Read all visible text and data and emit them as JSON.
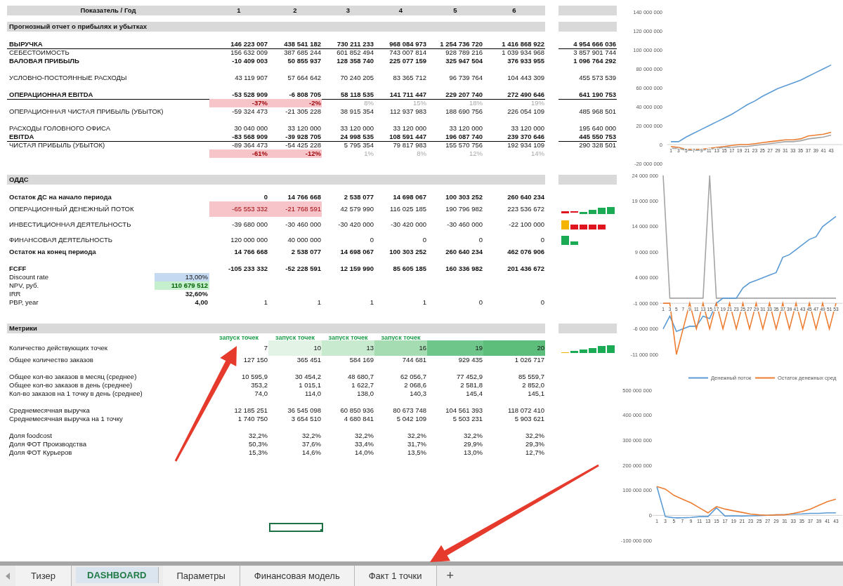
{
  "header": {
    "label": "Показатель / Год",
    "years": [
      "1",
      "2",
      "3",
      "4",
      "5",
      "6"
    ]
  },
  "sections": [
    {
      "title": "Прогнозный отчет о прибылях и убытках",
      "groups": [
        [
          {
            "label": "ВЫРУЧКА",
            "kind": "bold",
            "underline": true,
            "cells": [
              "146 223 007",
              "438 541 182",
              "730 211 233",
              "968 084 973",
              "1 254 736 720",
              "1 416 868 922"
            ],
            "total": "4 954 666 036"
          },
          {
            "label": "СЕБЕСТОИМОСТЬ",
            "kind": "normal",
            "cells": [
              "156 632 009",
              "387 685 244",
              "601 852 494",
              "743 007 814",
              "928 789 216",
              "1 039 934 968"
            ],
            "total": "3 857 901 744"
          },
          {
            "label": "ВАЛОВАЯ ПРИБЫЛЬ",
            "kind": "bold",
            "cells": [
              "-10 409 003",
              "50 855 937",
              "128 358 740",
              "225 077 159",
              "325 947 504",
              "376 933 955"
            ],
            "total": "1 096 764 292"
          }
        ],
        [
          {
            "label": "УСЛОВНО-ПОСТОЯННЫЕ РАСХОДЫ",
            "kind": "normal",
            "cells": [
              "43 119 907",
              "57 664 642",
              "70 240 205",
              "83 365 712",
              "96 739 764",
              "104 443 309"
            ],
            "total": "455 573 539"
          }
        ],
        [
          {
            "label": "ОПЕРАЦИОННАЯ EBITDA",
            "kind": "bold",
            "underline": true,
            "cells": [
              "-53 528 909",
              "-6 808 705",
              "58 118 535",
              "141 711 447",
              "229 207 740",
              "272 490 646"
            ],
            "total": "641 190 753"
          },
          {
            "kind": "pct",
            "cells": [
              {
                "text": "-37%",
                "highlighted": true
              },
              {
                "text": "-2%",
                "highlighted": true
              },
              {
                "text": "8%",
                "highlighted": false
              },
              {
                "text": "15%",
                "highlighted": false
              },
              {
                "text": "18%",
                "highlighted": false
              },
              {
                "text": "19%",
                "highlighted": false
              }
            ]
          },
          {
            "label": "ОПЕРАЦИОННАЯ ЧИСТАЯ ПРИБЫЛЬ (УБЫТОК)",
            "kind": "normal",
            "cells": [
              "-59 324 473",
              "-21 305 228",
              "38 915 354",
              "112 937 983",
              "188 690 756",
              "226 054 109"
            ],
            "total": "485 968 501"
          }
        ],
        [
          {
            "label": "РАСХОДЫ ГОЛОВНОГО ОФИСА",
            "kind": "normal",
            "cells": [
              "30 040 000",
              "33 120 000",
              "33 120 000",
              "33 120 000",
              "33 120 000",
              "33 120 000"
            ],
            "total": "195 640 000"
          },
          {
            "label": "EBITDA",
            "kind": "bold",
            "underline": true,
            "cells": [
              "-83 568 909",
              "-39 928 705",
              "24 998 535",
              "108 591 447",
              "196 087 740",
              "239 370 646"
            ],
            "total": "445 550 753"
          },
          {
            "label": "ЧИСТАЯ ПРИБЫЛЬ (УБЫТОК)",
            "kind": "normal",
            "cells": [
              "-89 364 473",
              "-54 425 228",
              "5 795 354",
              "79 817 983",
              "155 570 756",
              "192 934 109"
            ],
            "total": "290 328 501"
          },
          {
            "kind": "pct",
            "cells": [
              {
                "text": "-61%",
                "highlighted": true
              },
              {
                "text": "-12%",
                "highlighted": true
              },
              {
                "text": "1%",
                "highlighted": false
              },
              {
                "text": "8%",
                "highlighted": false
              },
              {
                "text": "12%",
                "highlighted": false
              },
              {
                "text": "14%",
                "highlighted": false
              }
            ]
          }
        ]
      ]
    },
    {
      "title": "ОДДС",
      "groups": [
        [
          {
            "label": "Остаток ДС на начало периода",
            "kind": "bold",
            "cells": [
              "0",
              "14 766 668",
              "2 538 077",
              "14 698 067",
              "100 303 252",
              "260 640 234"
            ]
          },
          {
            "label": "ОПЕРАЦИОННЫЙ ДЕНЕЖНЫЙ ПОТОК",
            "kind": "normal",
            "sparkline": {
              "kind": "cashflow"
            },
            "cells": [
              {
                "text": "-65 553 332",
                "highlighted": true
              },
              {
                "text": "-21 768 591",
                "highlighted": true
              },
              {
                "text": "42 579 990",
                "highlighted": false
              },
              {
                "text": "116 025 185",
                "highlighted": false
              },
              {
                "text": "190 796 982",
                "highlighted": false
              },
              {
                "text": "223 536 672",
                "highlighted": false
              }
            ]
          },
          {
            "label": "ИНВЕСТИЦИОННАЯ ДЕЯТЕЛЬНОСТЬ",
            "kind": "normal",
            "sparkline": {
              "kind": "investing"
            },
            "cells": [
              "-39 680 000",
              "-30 460 000",
              "-30 420 000",
              "-30 420 000",
              "-30 460 000",
              "-22 100 000"
            ]
          },
          {
            "label": "ФИНАНСОВАЯ ДЕЯТЕЛЬНОСТЬ",
            "kind": "normal",
            "sparkline": {
              "kind": "financing"
            },
            "cells": [
              "120 000 000",
              "40 000 000",
              "0",
              "0",
              "0",
              "0"
            ]
          },
          {
            "label": "Остаток на конец периода",
            "kind": "bold",
            "cells": [
              "14 766 668",
              "2 538 077",
              "14 698 067",
              "100 303 252",
              "260 640 234",
              "462 076 906"
            ]
          }
        ],
        [
          {
            "label": "FCFF",
            "kind": "bold",
            "cells": [
              "-105 233 332",
              "-52 228 591",
              "12 159 990",
              "85 605 185",
              "160 336 982",
              "201 436 672"
            ]
          },
          {
            "label": "Discount rate",
            "kind": "normal",
            "param": {
              "text": "13,00%",
              "kind": "input"
            }
          },
          {
            "label": "NPV, руб.",
            "kind": "normal",
            "param": {
              "text": "110 679 512",
              "kind": "result"
            }
          },
          {
            "label": "IRR",
            "kind": "normal",
            "param": {
              "text": "32,60%",
              "kind": "bold"
            }
          },
          {
            "label": "PBP, year",
            "kind": "normal",
            "param": {
              "text": "4,00",
              "kind": "bold"
            },
            "cells": [
              "1",
              "1",
              "1",
              "1",
              "0",
              "0"
            ]
          }
        ]
      ]
    },
    {
      "title": "Метрики",
      "launches": [
        "запуск точек",
        "запуск точек",
        "запуск точек",
        "запуск точек"
      ],
      "groups": [
        [
          {
            "label": "Количество действующих точек",
            "kind": "normal",
            "sparkline": {
              "kind": "growth"
            },
            "cells": [
              {
                "text": "7"
              },
              {
                "text": "10",
                "color": "#e3f4e7"
              },
              {
                "text": "13",
                "color": "#c8eacf"
              },
              {
                "text": "16",
                "color": "#a5dcb2"
              },
              {
                "text": "19",
                "color": "#6fc68a"
              },
              {
                "text": "20",
                "color": "#5dbd7b"
              }
            ]
          },
          {
            "label": "Общее количество заказов",
            "kind": "normal",
            "cells": [
              "127 150",
              "365 451",
              "584 169",
              "744 681",
              "929 435",
              "1 026 717"
            ]
          }
        ],
        [
          {
            "label": "Общее кол-во заказов в месяц (среднее)",
            "kind": "normal",
            "cells": [
              "10 595,9",
              "30 454,2",
              "48 680,7",
              "62 056,7",
              "77 452,9",
              "85 559,7"
            ]
          },
          {
            "label": "Общее кол-во заказов в день (среднее)",
            "kind": "normal",
            "cells": [
              "353,2",
              "1 015,1",
              "1 622,7",
              "2 068,6",
              "2 581,8",
              "2 852,0"
            ]
          },
          {
            "label": "Кол-во заказов на 1 точку в день (среднее)",
            "kind": "normal",
            "cells": [
              "74,0",
              "114,0",
              "138,0",
              "140,3",
              "145,4",
              "145,1"
            ]
          }
        ],
        [
          {
            "label": "Среднемесячная выручка",
            "kind": "normal",
            "cells": [
              "12 185 251",
              "36 545 098",
              "60 850 936",
              "80 673 748",
              "104 561 393",
              "118 072 410"
            ]
          },
          {
            "label": "Среднемесячная выручка на 1 точку",
            "kind": "normal",
            "cells": [
              "1 740 750",
              "3 654 510",
              "4 680 841",
              "5 042 109",
              "5 503 231",
              "5 903 621"
            ]
          }
        ],
        [
          {
            "label": "Доля foodcost",
            "kind": "normal",
            "cells": [
              "32,2%",
              "32,2%",
              "32,2%",
              "32,2%",
              "32,2%",
              "32,2%"
            ]
          },
          {
            "label": "Доля ФОТ Производства",
            "kind": "normal",
            "cells": [
              "50,3%",
              "37,6%",
              "33,4%",
              "31,7%",
              "29,9%",
              "29,3%"
            ]
          },
          {
            "label": "Доля ФОТ Курьеров",
            "kind": "normal",
            "cells": [
              "15,3%",
              "14,6%",
              "14,0%",
              "13,5%",
              "13,0%",
              "12,7%"
            ]
          }
        ]
      ]
    }
  ],
  "selection": {
    "visible": true
  },
  "charts": [
    {
      "chart_data": {
        "type": "line",
        "x": [
          1,
          3,
          5,
          7,
          9,
          11,
          13,
          15,
          17,
          19,
          21,
          23,
          25,
          27,
          29,
          31,
          33,
          35,
          37,
          39,
          41,
          43
        ],
        "xticks": [
          1,
          3,
          5,
          7,
          9,
          11,
          13,
          15,
          17,
          19,
          21,
          23,
          25,
          27,
          29,
          31,
          33,
          35,
          37,
          39,
          41,
          43
        ],
        "xlim": [
          0,
          46
        ],
        "ylim": [
          -20000000,
          140000000
        ],
        "yticks": [
          {
            "value": -20000000,
            "label": "-20 000 000"
          },
          {
            "value": 0,
            "label": "0"
          },
          {
            "value": 20000000,
            "label": "20 000 000"
          },
          {
            "value": 40000000,
            "label": "40 000 000"
          },
          {
            "value": 60000000,
            "label": "60 000 000"
          },
          {
            "value": 80000000,
            "label": "80 000 000"
          },
          {
            "value": 100000000,
            "label": "100 000 000"
          },
          {
            "value": 120000000,
            "label": "120 000 000"
          },
          {
            "value": 140000000,
            "label": "140 000 000"
          }
        ],
        "series": [
          {
            "color": "#5b9bd5",
            "values": [
              3000000,
              3000000,
              8000000,
              12000000,
              16000000,
              20000000,
              24000000,
              28000000,
              32000000,
              37000000,
              42000000,
              46000000,
              51000000,
              55000000,
              59000000,
              62000000,
              65000000,
              68000000,
              72000000,
              76000000,
              80000000,
              84000000
            ]
          },
          {
            "color": "#ed7d31",
            "values": [
              -2000000,
              -3000000,
              -5000000,
              -5000000,
              -5000000,
              -4000000,
              -3000000,
              -2000000,
              -1000000,
              0,
              0,
              1000000,
              2000000,
              3000000,
              4000000,
              5000000,
              5000000,
              6000000,
              9000000,
              10000000,
              11000000,
              13000000
            ]
          },
          {
            "color": "#a5a5a5",
            "values": [
              -4000000,
              -4000000,
              -6000000,
              -6000000,
              -6000000,
              -5000000,
              -4000000,
              -3000000,
              -3000000,
              -2000000,
              -2000000,
              -1000000,
              0,
              1000000,
              2000000,
              3000000,
              3000000,
              4000000,
              6000000,
              7000000,
              8000000,
              10000000
            ]
          }
        ]
      }
    },
    {
      "chart_data": {
        "type": "line",
        "x": [
          1,
          3,
          5,
          7,
          9,
          11,
          13,
          15,
          17,
          19,
          21,
          23,
          25,
          27,
          29,
          31,
          33,
          35,
          37,
          39,
          41,
          43,
          45,
          47,
          49,
          51,
          53
        ],
        "xticks": [
          1,
          3,
          5,
          7,
          9,
          11,
          13,
          15,
          17,
          19,
          21,
          23,
          25,
          27,
          29,
          31,
          33,
          35,
          37,
          39,
          41,
          43,
          45,
          47,
          49,
          51,
          53
        ],
        "xlim": [
          0,
          55
        ],
        "ylim": [
          -11000000,
          24000000
        ],
        "legend": "bottom",
        "yticks": [
          {
            "value": -11000000,
            "label": "-11 000 000"
          },
          {
            "value": -6000000,
            "label": "-6 000 000"
          },
          {
            "value": -1000000,
            "label": "-1 000 000"
          },
          {
            "value": 4000000,
            "label": "4 000 000"
          },
          {
            "value": 9000000,
            "label": "9 000 000"
          },
          {
            "value": 14000000,
            "label": "14 000 000"
          },
          {
            "value": 19000000,
            "label": "19 000 000"
          },
          {
            "value": 24000000,
            "label": "24 000 000"
          }
        ],
        "series": [
          {
            "color": "#a5a5a5",
            "values": [
              24000000,
              0,
              0,
              0,
              0,
              0,
              0,
              24000000,
              0,
              0,
              0,
              0,
              0,
              0,
              0,
              0,
              0,
              0,
              0,
              0,
              0,
              0,
              0,
              0,
              0,
              0,
              0
            ]
          },
          {
            "name": "Денежный поток",
            "color": "#5b9bd5",
            "values": [
              -6000000,
              -3500000,
              -6500000,
              -6000000,
              -5500000,
              -5500000,
              -3500000,
              -4000000,
              -1000000,
              0,
              0,
              0,
              2000000,
              3000000,
              3500000,
              4000000,
              4500000,
              5000000,
              8000000,
              8500000,
              9500000,
              10500000,
              11500000,
              12000000,
              14000000,
              15000000,
              16000000
            ]
          },
          {
            "name": "Остаток денежных сред",
            "color": "#ed7d31",
            "values": [
              -1000000,
              -1000000,
              -11000000,
              -6000000,
              -1000000,
              -6000000,
              -1000000,
              -6000000,
              -1000000,
              -6000000,
              -1000000,
              -6000000,
              -1000000,
              -6000000,
              -1000000,
              -6000000,
              -1000000,
              -6000000,
              -1000000,
              -6000000,
              -1000000,
              -6000000,
              -1000000,
              -6000000,
              -1000000,
              -6000000,
              -1000000
            ]
          }
        ]
      }
    },
    {
      "chart_data": {
        "type": "line",
        "x": [
          1,
          3,
          5,
          7,
          9,
          11,
          13,
          15,
          17,
          19,
          21,
          23,
          25,
          27,
          29,
          31,
          33,
          35,
          37,
          39,
          41,
          43
        ],
        "xticks": [
          1,
          3,
          5,
          7,
          9,
          11,
          13,
          15,
          17,
          19,
          21,
          23,
          25,
          27,
          29,
          31,
          33,
          35,
          37,
          39,
          41,
          43
        ],
        "xlim": [
          0,
          44.5
        ],
        "ylim": [
          -100000000,
          500000000
        ],
        "yticks": [
          {
            "value": -100000000,
            "label": "-100 000 000"
          },
          {
            "value": 0,
            "label": "0"
          },
          {
            "value": 100000000,
            "label": "100 000 000"
          },
          {
            "value": 200000000,
            "label": "200 000 000"
          },
          {
            "value": 300000000,
            "label": "300 000 000"
          },
          {
            "value": 400000000,
            "label": "400 000 000"
          },
          {
            "value": 500000000,
            "label": "500 000 000"
          }
        ],
        "series": [
          {
            "color": "#5b9bd5",
            "values": [
              115000000,
              -5000000,
              -10000000,
              -10000000,
              -8000000,
              -5000000,
              -5000000,
              30000000,
              -3000000,
              -2000000,
              -3000000,
              -2000000,
              -1000000,
              0,
              2000000,
              3000000,
              5000000,
              6000000,
              8000000,
              8000000,
              10000000,
              10000000
            ]
          },
          {
            "color": "#ed7d31",
            "values": [
              115000000,
              105000000,
              80000000,
              65000000,
              50000000,
              30000000,
              10000000,
              35000000,
              25000000,
              18000000,
              12000000,
              5000000,
              2000000,
              0,
              2000000,
              2000000,
              8000000,
              15000000,
              25000000,
              40000000,
              55000000,
              65000000
            ]
          }
        ]
      }
    }
  ],
  "tabs": [
    {
      "label": "Тизер",
      "selected": false
    },
    {
      "label": "DASHBOARD",
      "selected": true
    },
    {
      "label": "Параметры",
      "selected": false
    },
    {
      "label": "Финансовая модель",
      "selected": false
    },
    {
      "label": "Факт 1 точки",
      "selected": false
    }
  ],
  "add_sheet": "+"
}
